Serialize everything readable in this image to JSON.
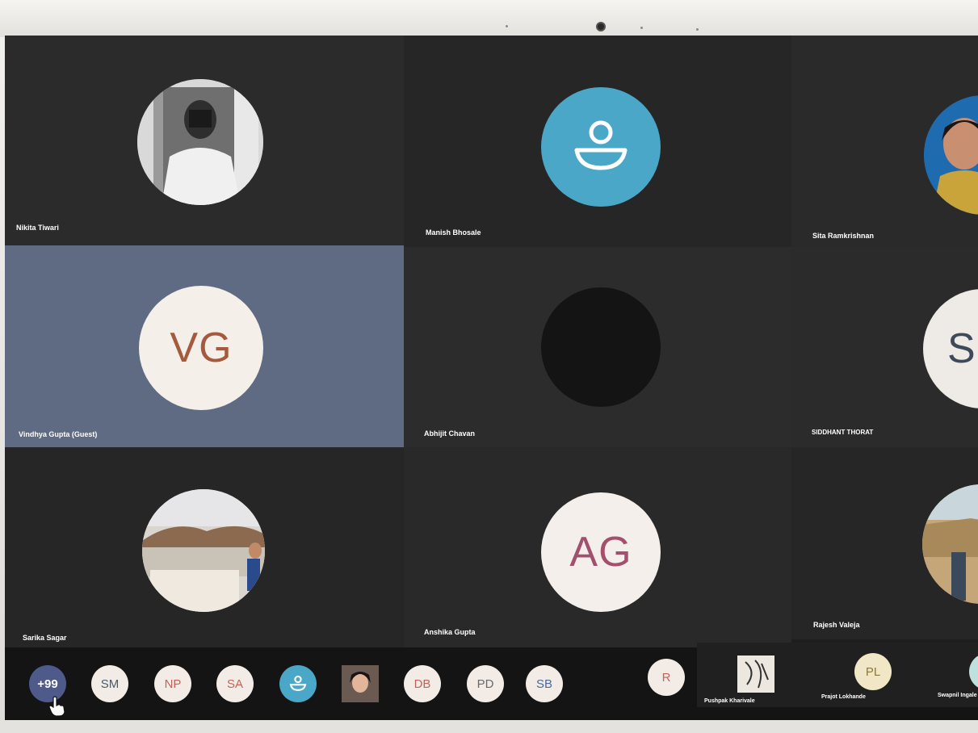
{
  "tiles": [
    {
      "name": "Nikita Tiwari",
      "avatar": "photo-mirror-selfie-icon"
    },
    {
      "name": "Manish Bhosale",
      "avatar": "default-person-icon"
    },
    {
      "name": "Sita Ramkrishnan",
      "avatar": "photo-woman-icon"
    },
    {
      "name": "Vindhya Gupta (Guest)",
      "initials": "VG"
    },
    {
      "name": "Abhijit Chavan",
      "avatar": "dark-photo-icon"
    },
    {
      "name": "SIDDHANT THORAT",
      "initials": "S"
    },
    {
      "name": "Sarika Sagar",
      "avatar": "photo-landscape-woman-icon"
    },
    {
      "name": "Anshika Gupta",
      "initials": "AG"
    },
    {
      "name": "Rajesh Valeja",
      "avatar": "photo-desert-icon"
    }
  ],
  "bar": {
    "more": "+99",
    "chips": [
      "SM",
      "NP",
      "SA",
      "DB",
      "PD",
      "SB",
      "R"
    ],
    "right": [
      {
        "name": "Pushpak Kharivale",
        "avatar": "sketch-photo-icon"
      },
      {
        "name": "Prajot Lokhande",
        "initials": "PL"
      },
      {
        "name": "Swapnil Ingale",
        "avatar": "teal-avatar-icon"
      }
    ]
  },
  "colors": {
    "tile_dark": "#2a2a2a",
    "tile_blue": "#5f6a83",
    "accent_teal": "#4aa7c7",
    "vg_text": "#a55a3d",
    "ag_text": "#a2506d",
    "plus_bg": "#4e5a8a"
  }
}
